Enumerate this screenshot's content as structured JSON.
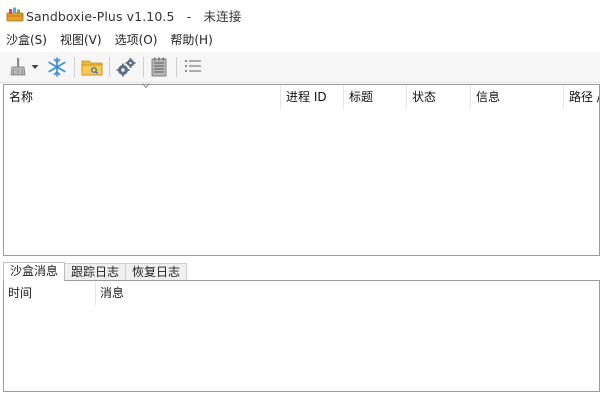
{
  "window": {
    "title": "Sandboxie-Plus v1.10.5   -   未连接"
  },
  "menu": [
    {
      "label": "沙盒(S)"
    },
    {
      "label": "视图(V)"
    },
    {
      "label": "选项(O)"
    },
    {
      "label": "帮助(H)"
    }
  ],
  "toolbar": {
    "icons": [
      "broom-icon",
      "dropdown-arrow-icon",
      "snowflake-icon",
      "folder-icon",
      "gears-icon",
      "notepad-icon",
      "list-icon"
    ]
  },
  "sandbox_table": {
    "columns": [
      "名称",
      "进程 ID",
      "标题",
      "状态",
      "信息",
      "路径 /"
    ]
  },
  "log_tabs": [
    {
      "label": "沙盒消息",
      "active": true
    },
    {
      "label": "跟踪日志",
      "active": false
    },
    {
      "label": "恢复日志",
      "active": false
    }
  ],
  "message_table": {
    "columns": [
      "时间",
      "消息"
    ]
  },
  "colors": {
    "toolbar_bg": "#f6f6f6",
    "border": "#9a9a9a",
    "icon_blue": "#3a8fd8",
    "icon_folder": "#f2b637"
  }
}
